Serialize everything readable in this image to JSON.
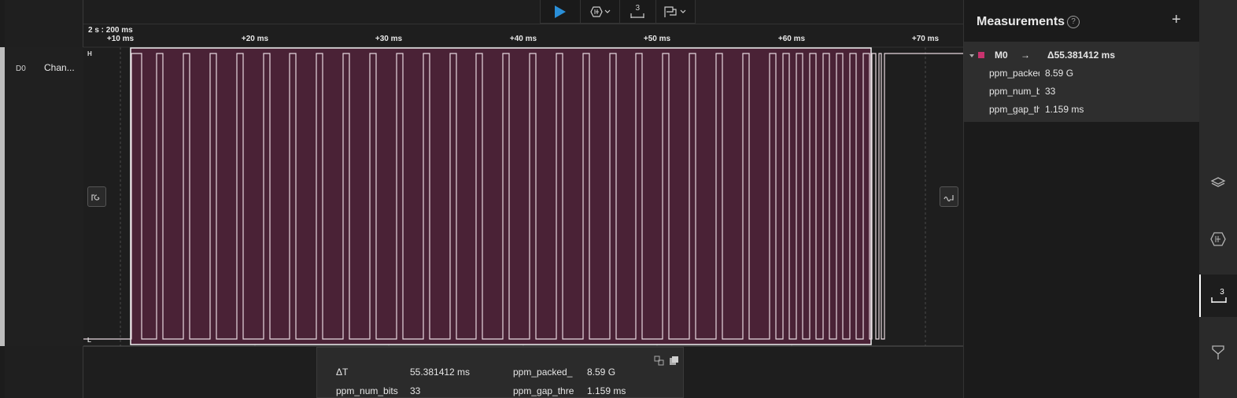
{
  "channel": {
    "id": "D0",
    "name": "Chan..."
  },
  "toolbar": {
    "measure_count": "3"
  },
  "ruler": {
    "timescale": "2 s : 200 ms",
    "ticks": [
      {
        "label": "+10 ms"
      },
      {
        "label": "+20 ms"
      },
      {
        "label": "+30 ms"
      },
      {
        "label": "+40 ms"
      },
      {
        "label": "+50 ms"
      },
      {
        "label": "+60 ms"
      },
      {
        "label": "+70 ms"
      }
    ]
  },
  "waveform": {
    "high_label": "H",
    "low_label": "L",
    "trace_color": "#e8d8e0",
    "selection_fill": "#4a2236"
  },
  "popup": {
    "dt_label": "ΔT",
    "dt_value": "55.381412 ms",
    "packed_label": "ppm_packed_",
    "packed_value": "8.59 G",
    "numbits_label": "ppm_num_bits",
    "numbits_value": "33",
    "gap_label": "ppm_gap_thre",
    "gap_value": "1.159 ms"
  },
  "measurements": {
    "title": "Measurements",
    "help": "?",
    "add": "+",
    "item": {
      "name": "M0",
      "arrow": "→",
      "delta": "Δ55.381412 ms",
      "color": "#c8336e",
      "rows": [
        {
          "label": "ppm_packed",
          "value": "8.59 G"
        },
        {
          "label": "ppm_num_bits",
          "value": "33"
        },
        {
          "label": "ppm_gap_threshold",
          "value": "1.159 ms"
        }
      ]
    }
  },
  "rail": {
    "measure_count": "3"
  },
  "colors": {
    "play": "#2a8fd8",
    "marker": "#c8336e",
    "accent_white": "#ffffff"
  }
}
